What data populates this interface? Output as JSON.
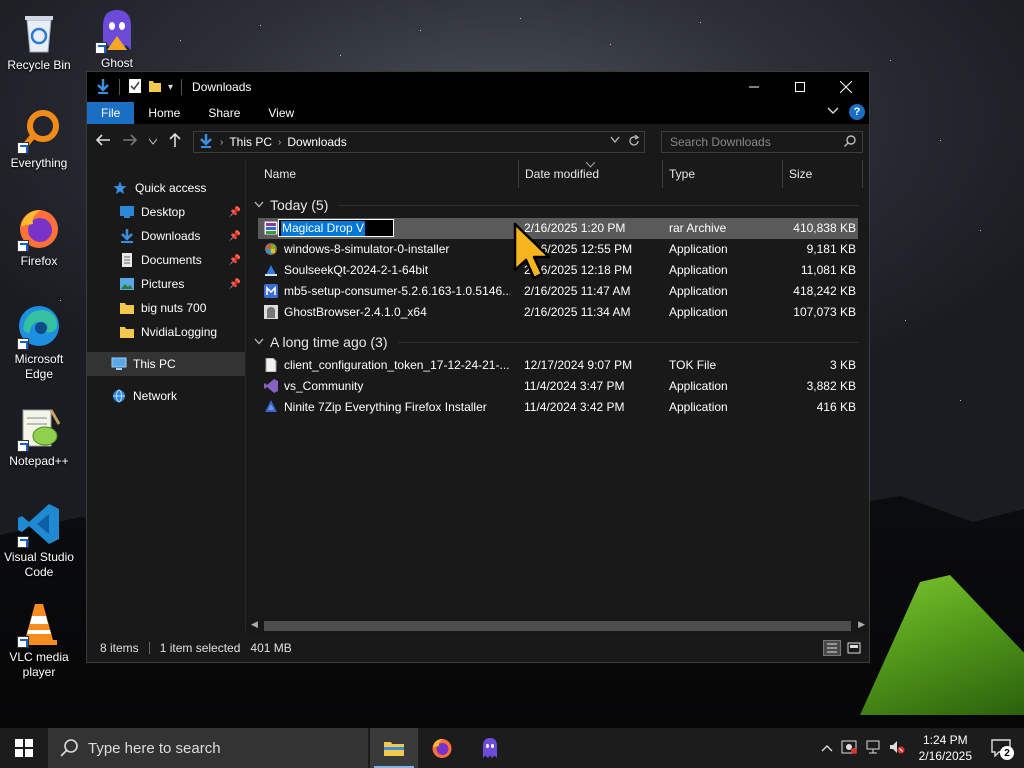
{
  "desktop": {
    "icons": [
      {
        "label": "Recycle Bin"
      },
      {
        "label": "Ghost"
      },
      {
        "label": "Everything"
      },
      {
        "label": "Firefox"
      },
      {
        "label": "Microsoft Edge"
      },
      {
        "label": "Notepad++"
      },
      {
        "label": "Visual Studio Code"
      },
      {
        "label": "VLC media player"
      }
    ]
  },
  "window": {
    "title": "Downloads",
    "ribbon_tabs": [
      "File",
      "Home",
      "Share",
      "View"
    ],
    "address": {
      "crumbs": [
        "This PC",
        "Downloads"
      ]
    },
    "search": {
      "placeholder": "Search Downloads"
    },
    "nav": {
      "quick_access": "Quick access",
      "items": [
        {
          "label": "Desktop",
          "pinned": true
        },
        {
          "label": "Downloads",
          "pinned": true
        },
        {
          "label": "Documents",
          "pinned": true
        },
        {
          "label": "Pictures",
          "pinned": true
        },
        {
          "label": "big nuts 700",
          "pinned": false
        },
        {
          "label": "NvidiaLogging",
          "pinned": false
        }
      ],
      "this_pc": "This PC",
      "network": "Network"
    },
    "columns": {
      "name": "Name",
      "date": "Date modified",
      "type": "Type",
      "size": "Size"
    },
    "groups": [
      {
        "title": "Today (5)",
        "files": [
          {
            "name": "Magical Drop V",
            "date": "2/16/2025 1:20 PM",
            "type": "rar Archive",
            "size": "410,838 KB",
            "icon": "rar-archive-icon",
            "renaming": true
          },
          {
            "name": "windows-8-simulator-0-installer",
            "date": "2/16/2025 12:55 PM",
            "type": "Application",
            "size": "9,181 KB",
            "icon": "installer-icon"
          },
          {
            "name": "SoulseekQt-2024-2-1-64bit",
            "date": "2/16/2025 12:18 PM",
            "type": "Application",
            "size": "11,081 KB",
            "icon": "soulseek-icon"
          },
          {
            "name": "mb5-setup-consumer-5.2.6.163-1.0.5146...",
            "date": "2/16/2025 11:47 AM",
            "type": "Application",
            "size": "418,242 KB",
            "icon": "malwarebytes-icon"
          },
          {
            "name": "GhostBrowser-2.4.1.0_x64",
            "date": "2/16/2025 11:34 AM",
            "type": "Application",
            "size": "107,073 KB",
            "icon": "ghost-browser-icon"
          }
        ]
      },
      {
        "title": "A long time ago (3)",
        "files": [
          {
            "name": "client_configuration_token_17-12-24-21-...",
            "date": "12/17/2024 9:07 PM",
            "type": "TOK File",
            "size": "3 KB",
            "icon": "blank-file-icon"
          },
          {
            "name": "vs_Community",
            "date": "11/4/2024 3:47 PM",
            "type": "Application",
            "size": "3,882 KB",
            "icon": "visual-studio-icon"
          },
          {
            "name": "Ninite 7Zip Everything Firefox Installer",
            "date": "11/4/2024 3:42 PM",
            "type": "Application",
            "size": "416 KB",
            "icon": "ninite-icon"
          }
        ]
      }
    ],
    "status": {
      "items": "8 items",
      "selected": "1 item selected",
      "size": "401 MB"
    }
  },
  "taskbar": {
    "search_placeholder": "Type here to search",
    "time": "1:24 PM",
    "date": "2/16/2025",
    "notification_count": "2"
  },
  "colors": {
    "accent": "#1a6fc4",
    "selected_row": "#5a5a5a",
    "window_bg": "#191919"
  }
}
